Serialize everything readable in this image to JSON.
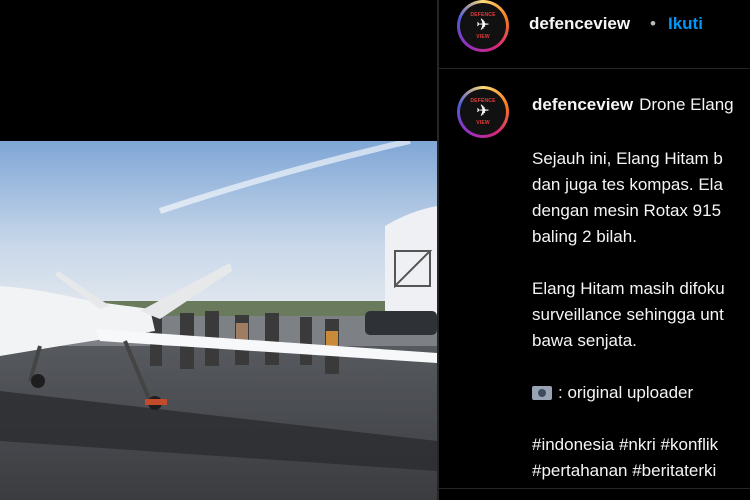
{
  "post": {
    "username": "defenceview",
    "dot": "•",
    "follow_label": "Ikuti",
    "avatar_text": "DEFENCE VIEW",
    "caption_title": "Drone Elang",
    "lines": [
      "Sejauh ini, Elang Hitam b",
      "dan juga tes kompas. Ela",
      "dengan mesin Rotax 915",
      "baling 2 bilah."
    ],
    "lines2": [
      "Elang Hitam masih difoku",
      "surveillance sehingga unt",
      "bawa senjata."
    ],
    "credit": ": original uploader",
    "hashtags1": "#indonesia #nkri #konflik",
    "hashtags2": "#pertahanan #beritaterki"
  },
  "colors": {
    "background": "#000000",
    "link": "#0095f6",
    "text": "#f5f5f5"
  },
  "icons": [
    "plane-icon",
    "camera-icon"
  ]
}
